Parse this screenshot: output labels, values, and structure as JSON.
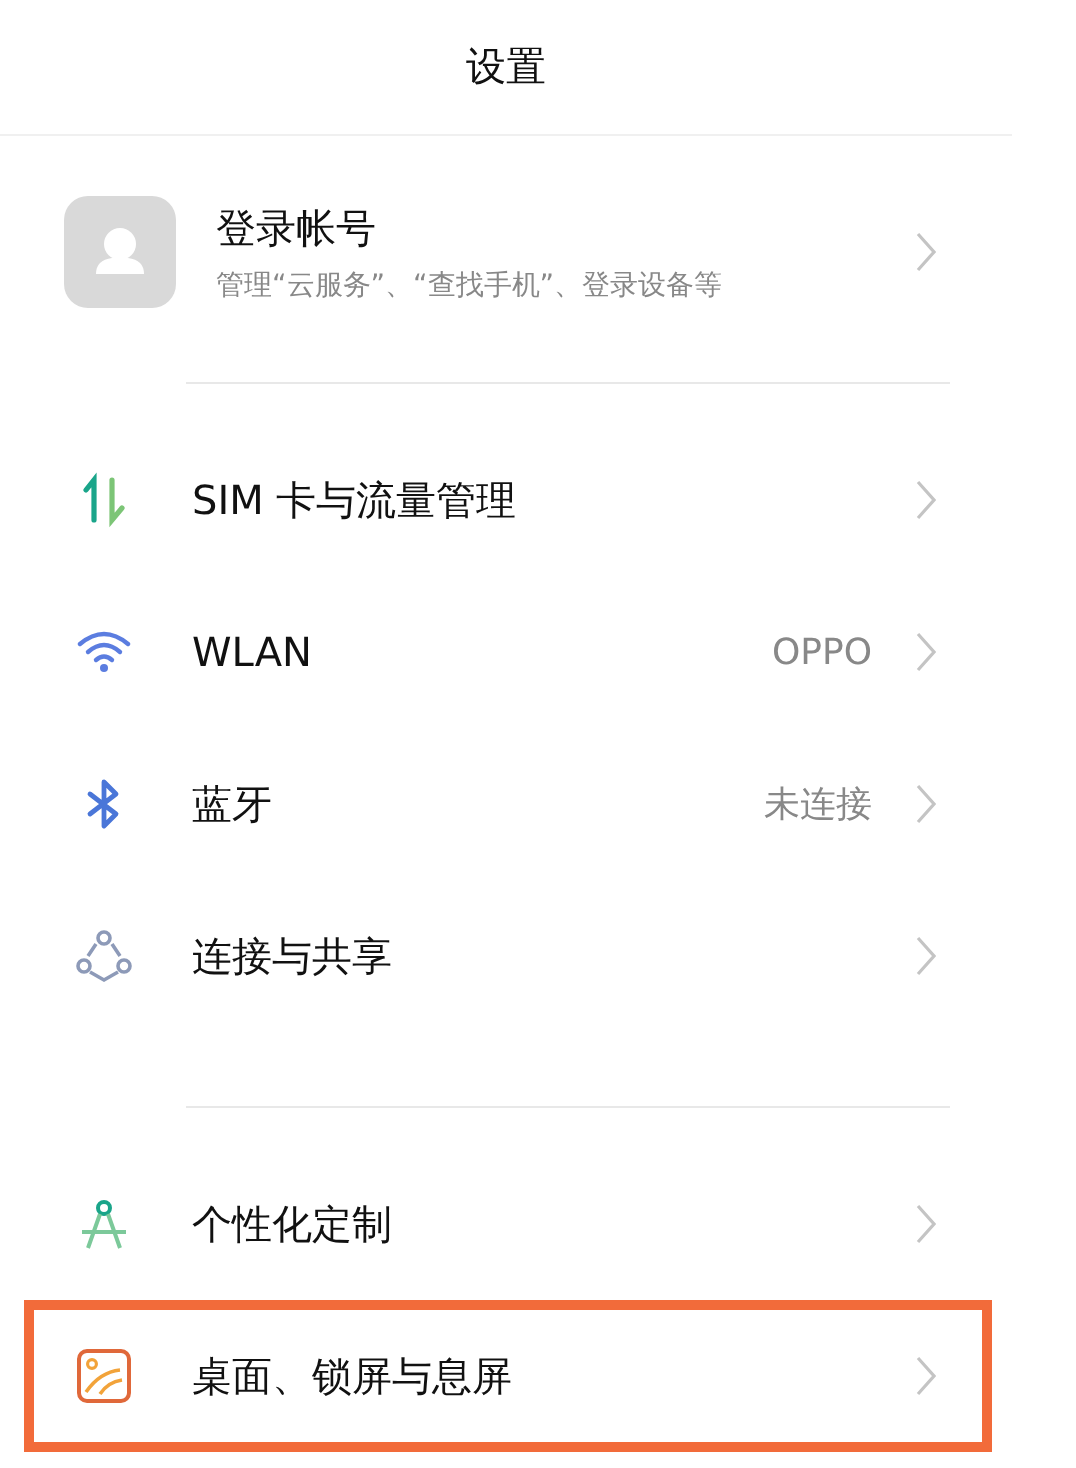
{
  "header": {
    "title": "设置"
  },
  "account": {
    "title": "登录帐号",
    "subtitle": "管理“云服务”、“查找手机”、登录设备等"
  },
  "groups": [
    {
      "items": [
        {
          "kind": "sim",
          "label": "SIM 卡与流量管理",
          "highlighted": false
        },
        {
          "kind": "wifi",
          "label": "WLAN",
          "value": "OPPO",
          "highlighted": false
        },
        {
          "kind": "bluetooth",
          "label": "蓝牙",
          "value": "未连接",
          "highlighted": false
        },
        {
          "kind": "share",
          "label": "连接与共享",
          "highlighted": false
        }
      ]
    },
    {
      "items": [
        {
          "kind": "compass",
          "label": "个性化定制",
          "highlighted": false
        },
        {
          "kind": "wallpaper",
          "label": "桌面、锁屏与息屏",
          "highlighted": true
        }
      ]
    }
  ]
}
